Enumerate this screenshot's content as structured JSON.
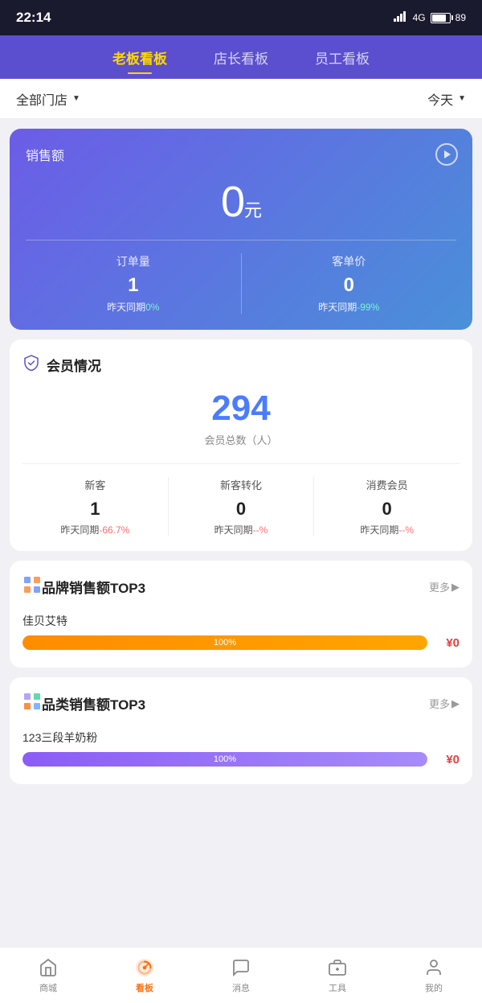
{
  "statusBar": {
    "time": "22:14",
    "signal": "HD 4G",
    "battery": "89"
  },
  "topNav": {
    "tabs": [
      {
        "id": "boss",
        "label": "老板看板",
        "active": true
      },
      {
        "id": "manager",
        "label": "店长看板",
        "active": false
      },
      {
        "id": "staff",
        "label": "员工看板",
        "active": false
      }
    ]
  },
  "filterBar": {
    "storeLabel": "全部门店",
    "dateLabel": "今天"
  },
  "salesCard": {
    "title": "销售额",
    "amount": "0",
    "unit": "元",
    "ordersLabel": "订单量",
    "ordersValue": "1",
    "ordersCompareLabel": "昨天同期",
    "ordersCompareValue": "0%",
    "priceLabel": "客单价",
    "priceValue": "0",
    "priceCompareLabel": "昨天同期",
    "priceCompareValue": "-99%"
  },
  "memberSection": {
    "title": "会员情况",
    "totalCount": "294",
    "totalCountLabel": "会员总数（人）",
    "stats": [
      {
        "label": "新客",
        "value": "1",
        "compareLabel": "昨天同期",
        "compareValue": "-66.7%"
      },
      {
        "label": "新客转化",
        "value": "0",
        "compareLabel": "昨天同期",
        "compareValue": "--%"
      },
      {
        "label": "消费会员",
        "value": "0",
        "compareLabel": "昨天同期",
        "compareValue": "--%"
      }
    ]
  },
  "brandTop3": {
    "title": "品牌销售额TOP3",
    "moreLabel": "更多",
    "items": [
      {
        "name": "佳贝艾特",
        "percentage": 100,
        "value": "¥0",
        "barClass": "orange"
      }
    ]
  },
  "categoryTop3": {
    "title": "品类销售额TOP3",
    "moreLabel": "更多",
    "items": [
      {
        "name": "123三段羊奶粉",
        "percentage": 100,
        "value": "¥0",
        "barClass": "purple"
      }
    ]
  },
  "bottomNav": {
    "items": [
      {
        "id": "store",
        "label": "商城",
        "active": false
      },
      {
        "id": "dashboard",
        "label": "看板",
        "active": true
      },
      {
        "id": "message",
        "label": "消息",
        "active": false
      },
      {
        "id": "tools",
        "label": "工具",
        "active": false
      },
      {
        "id": "mine",
        "label": "我的",
        "active": false
      }
    ]
  }
}
